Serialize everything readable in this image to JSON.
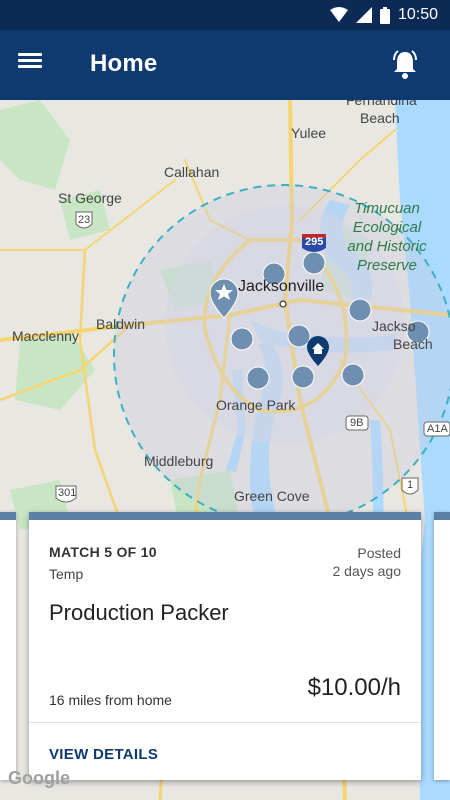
{
  "status_bar": {
    "time": "10:50"
  },
  "app_bar": {
    "title": "Home"
  },
  "map": {
    "labels": {
      "fernandina": "Fernandina",
      "fernandina_beach": "Beach",
      "yulee": "Yulee",
      "callahan": "Callahan",
      "st_george": "St George",
      "route_23": "23",
      "route_295": "295",
      "jacksonville": "Jacksonville",
      "baldwin": "Baldwin",
      "macclenny": "Macclenny",
      "jax_beach_1": "Jackso",
      "jax_beach_2": "Beach",
      "timucuan_1": "Timucuan",
      "timucuan_2": "Ecological",
      "timucuan_3": "and Historic",
      "timucuan_4": "Preserve",
      "orange_park": "Orange Park",
      "route_9b": "9B",
      "a1a": "A1A",
      "middleburg": "Middleburg",
      "route_301": "301",
      "route_1": "1",
      "green_cove": "Green Cove",
      "google": "Google"
    },
    "colors": {
      "land": "#e9e7e2",
      "water": "#aadaff",
      "park": "#c5e8c5",
      "road": "#f7d774",
      "radius": "#3ab0c4",
      "pin": "#6f8fb0"
    }
  },
  "job_card": {
    "match": "MATCH 5 OF 10",
    "type": "Temp",
    "posted_line1": "Posted",
    "posted_line2": "2 days ago",
    "title": "Production Packer",
    "distance": "16 miles from home",
    "rate": "$10.00/h",
    "action": "VIEW DETAILS"
  }
}
